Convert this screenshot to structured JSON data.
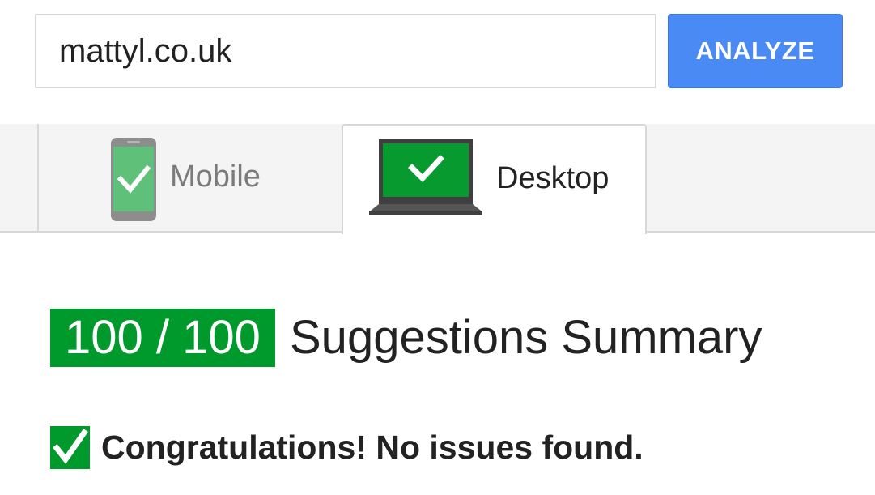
{
  "search": {
    "url_value": "mattyl.co.uk",
    "analyze_label": "ANALYZE"
  },
  "tabs": [
    {
      "label": "Mobile",
      "icon": "phone-check-icon",
      "selected": false
    },
    {
      "label": "Desktop",
      "icon": "laptop-check-icon",
      "selected": true
    }
  ],
  "result": {
    "score": "100 / 100",
    "summary_title": "Suggestions Summary",
    "message": "Congratulations! No issues found.",
    "message_icon": "checkmark-icon"
  },
  "colors": {
    "accent_blue": "#4a8af4",
    "pass_green": "#009a2c",
    "mobile_green": "#5fc07a",
    "desktop_green": "#079a2e",
    "device_gray": "#6f6f6f"
  }
}
